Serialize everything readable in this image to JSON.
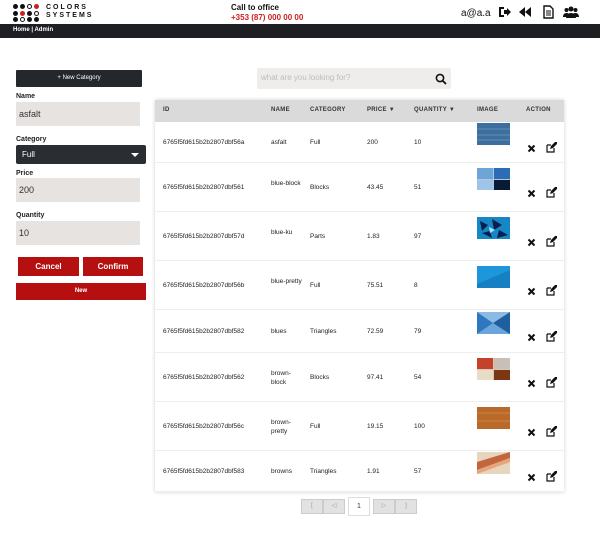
{
  "header": {
    "logo_line1": "COLORS",
    "logo_line2": "SYSTEMS",
    "office_label": "Call to office",
    "office_phone": "+353 (87) 000 00 00",
    "user": "a@a.a",
    "icons": [
      "logout-icon",
      "back-icon",
      "document-icon",
      "users-icon"
    ]
  },
  "breadcrumb": "Home | Admin",
  "sidebar": {
    "new_category_label": "+ New Category",
    "name_label": "Name",
    "name_value": "asfalt",
    "category_label": "Category",
    "category_value": "Full",
    "price_label": "Price",
    "price_value": "200",
    "quantity_label": "Quantity",
    "quantity_value": "10",
    "cancel_label": "Cancel",
    "confirm_label": "Confirm",
    "new_label": "New"
  },
  "search": {
    "placeholder": "what are you looking for?"
  },
  "table": {
    "headers": {
      "id": "ID",
      "name": "NAME",
      "category": "CATEGORY",
      "price": "PRICE ▼",
      "quantity": "QUANTITY ▼",
      "image": "IMAGE",
      "action": "ACTION"
    },
    "rows": [
      {
        "id": "6765f5fd615b2b2807dbf56a",
        "name": "asfalt",
        "category": "Full",
        "price": "200",
        "quantity": "10",
        "image": "blue-texture"
      },
      {
        "id": "6765f5fd615b2b2807dbf561",
        "name": "blue-block",
        "category": "Blocks",
        "price": "43.45",
        "quantity": "51",
        "image": "blue-blocks"
      },
      {
        "id": "6765f5fd615b2b2807dbf57d",
        "name": "blue-ku",
        "category": "Parts",
        "price": "1.83",
        "quantity": "97",
        "image": "blue-parts"
      },
      {
        "id": "6765f5fd615b2b2807dbf56b",
        "name": "blue-pretty",
        "category": "Full",
        "price": "75.51",
        "quantity": "8",
        "image": "blue-full"
      },
      {
        "id": "6765f5fd615b2b2807dbf582",
        "name": "blues",
        "category": "Triangles",
        "price": "72.59",
        "quantity": "79",
        "image": "blue-triangles"
      },
      {
        "id": "6765f5fd615b2b2807dbf562",
        "name": "brown-block",
        "category": "Blocks",
        "price": "97.41",
        "quantity": "54",
        "image": "brown-blocks"
      },
      {
        "id": "6765f5fd615b2b2807dbf56c",
        "name": "brown-pretty",
        "category": "Full",
        "price": "19.15",
        "quantity": "100",
        "image": "brown-full"
      },
      {
        "id": "6765f5fd615b2b2807dbf583",
        "name": "browns",
        "category": "Triangles",
        "price": "1.91",
        "quantity": "57",
        "image": "brown-triangles"
      }
    ]
  },
  "pagination": {
    "first": "[",
    "prev": "◁",
    "current": "1",
    "next": "▷",
    "last": "]"
  }
}
